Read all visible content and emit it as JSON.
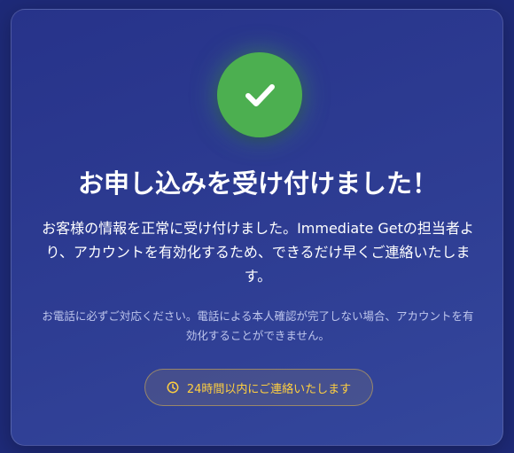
{
  "confirmation": {
    "title": "お申し込みを受け付けました！",
    "description": "お客様の情報を正常に受け付けました。Immediate Getの担当者より、アカウントを有効化するため、できるだけ早くご連絡いたします。",
    "note": "お電話に必ずご対応ください。電話による本人確認が完了しない場合、アカウントを有効化することができません。",
    "badge_text": "24時間以内にご連絡いたします"
  },
  "icons": {
    "success": "check-icon",
    "badge": "clock-icon"
  },
  "colors": {
    "success": "#4caf50",
    "badge_accent": "#ffcf40",
    "card_background": "#2e3d93"
  }
}
